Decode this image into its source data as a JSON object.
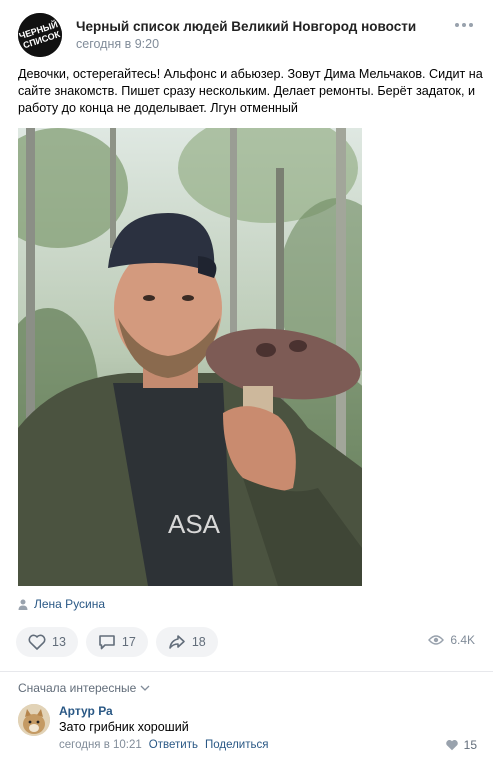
{
  "header": {
    "avatar_text_line1": "ЧЕРНЫЙ",
    "avatar_text_line2": "СПИСОК",
    "group_name": "Черный список людей Великий Новгород новости",
    "time": "сегодня в 9:20"
  },
  "post": {
    "text": "Девочки, остерегайтесь! Альфонс и абьюзер. Зовут Дима Мельчаков. Сидит на сайте знакомств. Пишет сразу нескольким. Делает ремонты. Берёт задаток, и работу до конца не доделывает. Лгун отменный",
    "photo_shirt_text": "ASA",
    "author": "Лена Русина"
  },
  "actions": {
    "likes": "13",
    "comments": "17",
    "shares": "18",
    "views": "6.4K"
  },
  "comments_section": {
    "sort_label": "Сначала интересные"
  },
  "comment": {
    "author": "Артур Ра",
    "text": "Зато грибник хороший",
    "time": "сегодня в 10:21",
    "reply_label": "Ответить",
    "share_label": "Поделиться",
    "likes": "15"
  },
  "colors": {
    "link": "#2a5885",
    "muted": "#818c99",
    "pill_bg": "#f2f3f5",
    "icon": "#99a2ad"
  }
}
